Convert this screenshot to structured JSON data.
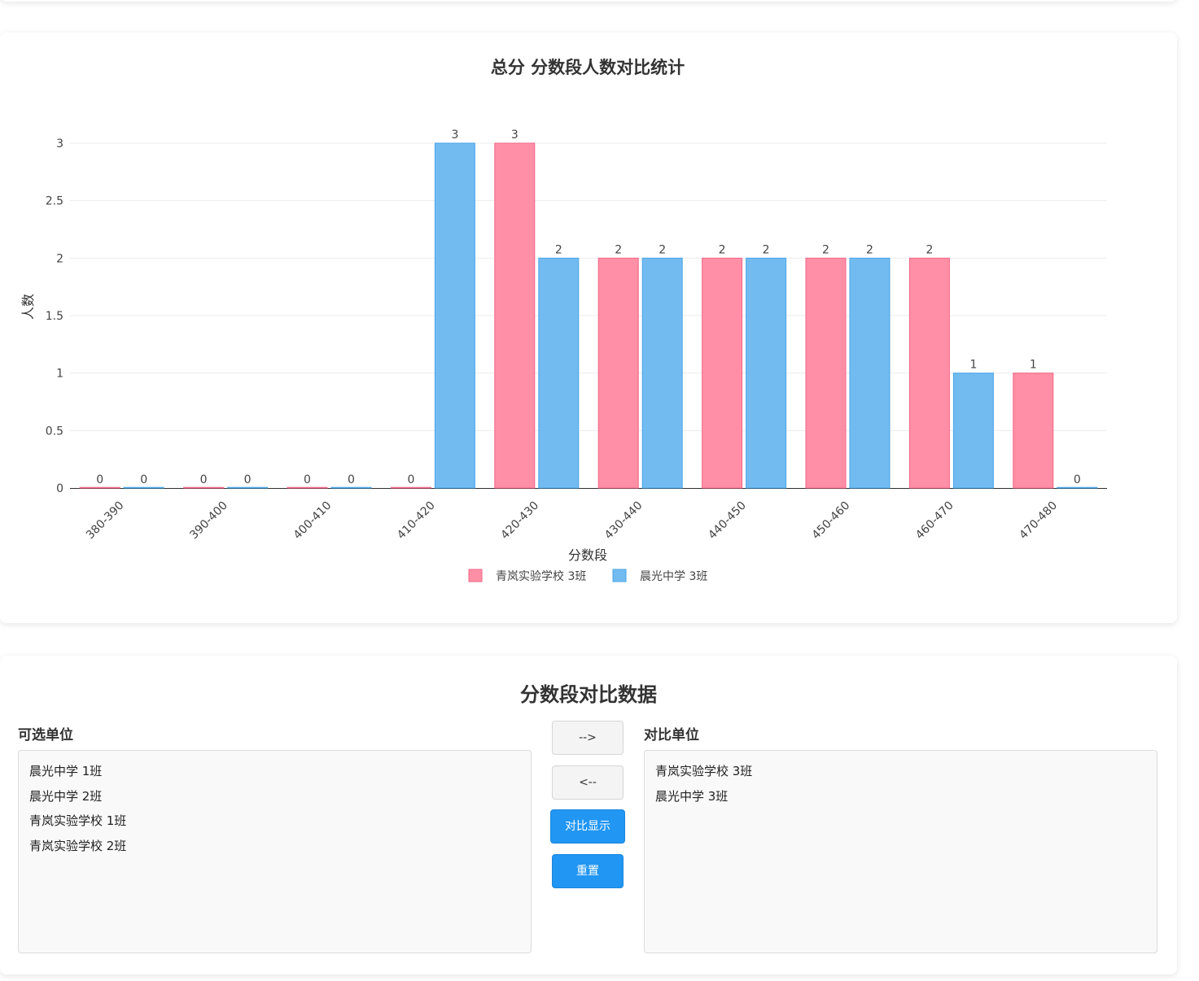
{
  "chart_data": {
    "type": "bar",
    "title": "总分 分数段人数对比统计",
    "xlabel": "分数段",
    "ylabel": "人数",
    "ylim": [
      0,
      3
    ],
    "yticks": [
      "0",
      "0.5",
      "1",
      "1.5",
      "2",
      "2.5",
      "3"
    ],
    "categories": [
      "380-390",
      "390-400",
      "400-410",
      "410-420",
      "420-430",
      "430-440",
      "440-450",
      "450-460",
      "460-470",
      "470-480"
    ],
    "series": [
      {
        "name": "青岚实验学校 3班",
        "color": "#ff8fa6",
        "values": [
          0,
          0,
          0,
          0,
          3,
          2,
          2,
          2,
          2,
          1
        ]
      },
      {
        "name": "晨光中学 3班",
        "color": "#72bbf0",
        "values": [
          0,
          0,
          0,
          3,
          2,
          2,
          2,
          2,
          1,
          0
        ]
      }
    ],
    "legend_position": "bottom-center",
    "grid": true
  },
  "comparison": {
    "title": "分数段对比数据",
    "available_label": "可选单位",
    "selected_label": "对比单位",
    "available_items": [
      "晨光中学 1班",
      "晨光中学 2班",
      "青岚实验学校 1班",
      "青岚实验学校 2班"
    ],
    "selected_items": [
      "青岚实验学校 3班",
      "晨光中学 3班"
    ],
    "move_right_label": "-->",
    "move_left_label": "<--",
    "compare_label": "对比显示",
    "reset_label": "重置"
  }
}
